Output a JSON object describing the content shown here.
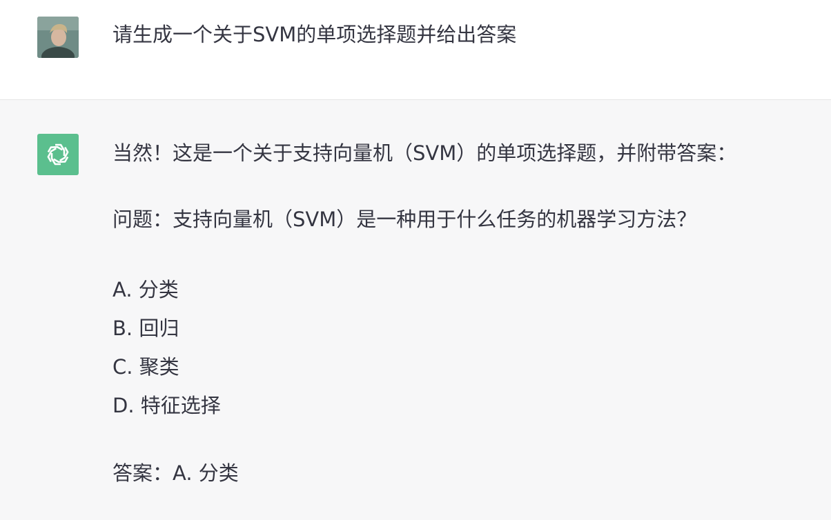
{
  "user_message": {
    "avatar": "user-photo-avatar",
    "text": "请生成一个关于SVM的单项选择题并给出答案"
  },
  "assistant_message": {
    "avatar": "openai-logo-icon",
    "accent_color": "#5bbf8e",
    "intro": "当然！这是一个关于支持向量机（SVM）的单项选择题，并附带答案：",
    "question": "问题：支持向量机（SVM）是一种用于什么任务的机器学习方法？",
    "options": [
      "A. 分类",
      "B. 回归",
      "C. 聚类",
      "D. 特征选择"
    ],
    "answer": "答案：A. 分类"
  }
}
